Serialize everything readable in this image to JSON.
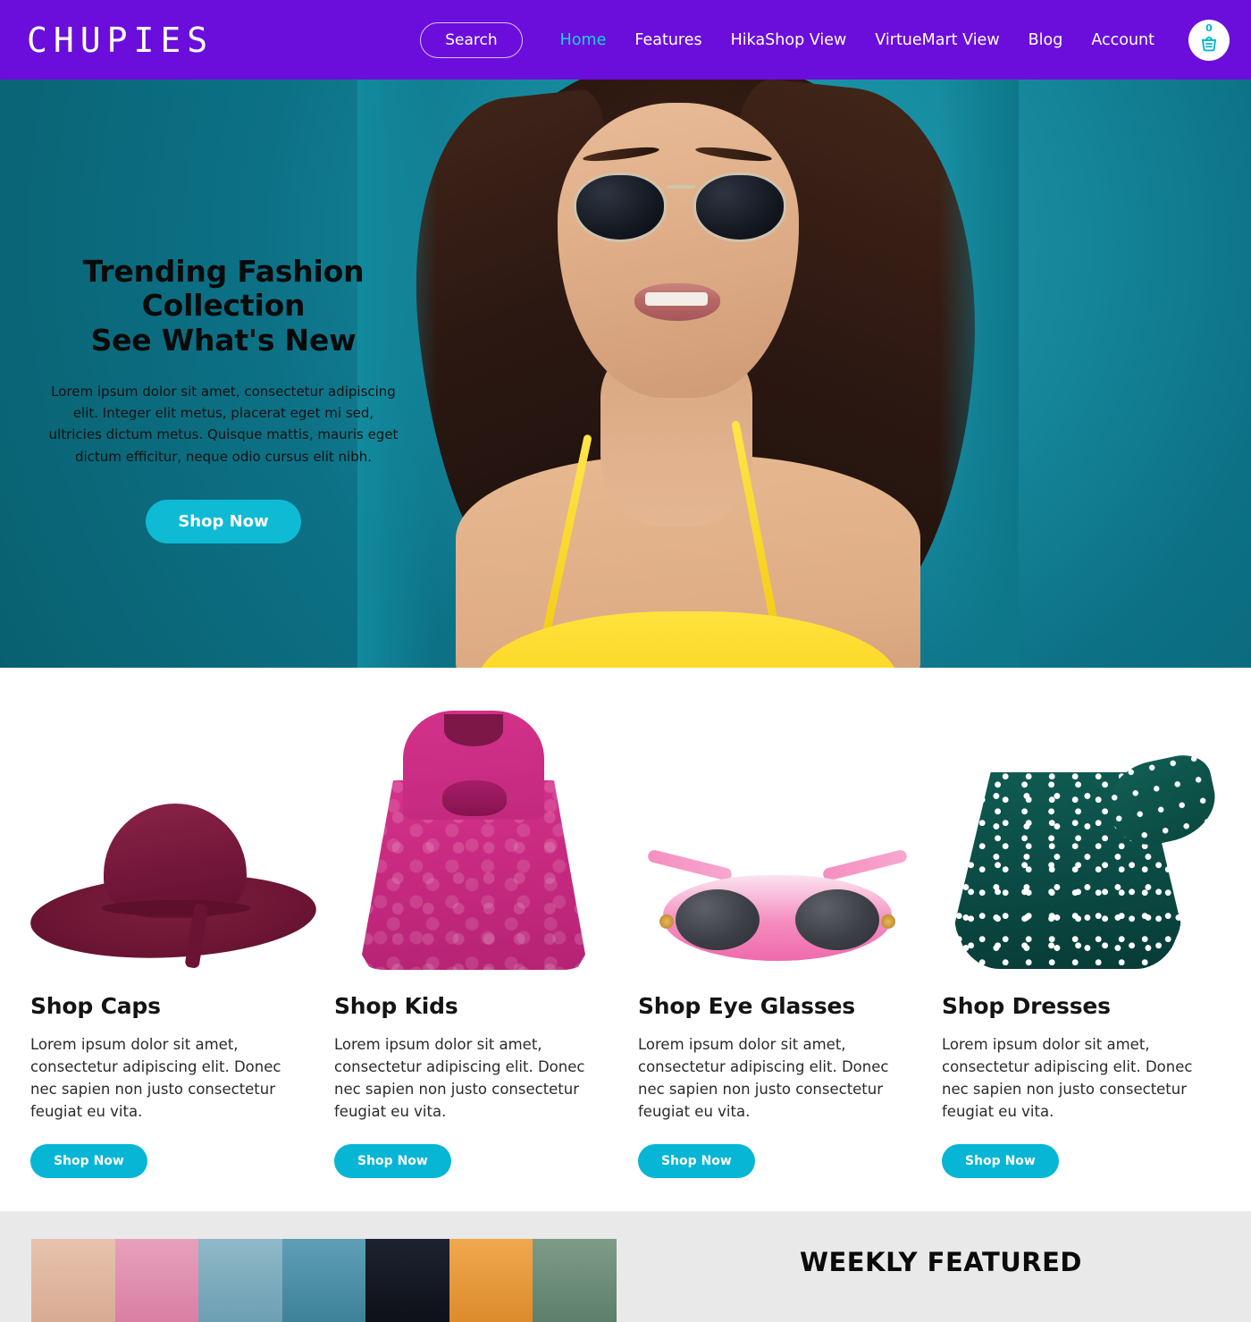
{
  "header": {
    "logo": "CHUPIES",
    "search_label": "Search",
    "nav": [
      {
        "label": "Home",
        "active": true
      },
      {
        "label": "Features",
        "active": false
      },
      {
        "label": "HikaShop View",
        "active": false
      },
      {
        "label": "VirtueMart View",
        "active": false
      },
      {
        "label": "Blog",
        "active": false
      },
      {
        "label": "Account",
        "active": false
      }
    ],
    "cart": {
      "count": "0",
      "icon": "shopping-basket-icon"
    },
    "brand_color": "#6b0edb",
    "accent_color": "#19d3e0"
  },
  "hero": {
    "title_line1": "Trending Fashion Collection",
    "title_line2": "See What's New",
    "description": "Lorem ipsum dolor sit amet, consectetur adipiscing elit. Integer elit metus, placerat eget mi sed, ultricies dictum metus. Quisque mattis, mauris eget dictum efficitur, neque odio cursus elit nibh.",
    "button_label": "Shop Now",
    "button_color": "#0fbad4",
    "background_color": "#0d7186"
  },
  "categories": [
    {
      "title": "Shop Caps",
      "description": "Lorem ipsum dolor sit amet, consectetur adipiscing elit. Donec nec sapien non justo consectetur feugiat eu vita.",
      "button_label": "Shop Now",
      "image_name": "burgundy-floppy-hat"
    },
    {
      "title": "Shop Kids",
      "description": "Lorem ipsum dolor sit amet, consectetur adipiscing elit. Donec nec sapien non justo consectetur feugiat eu vita.",
      "button_label": "Shop Now",
      "image_name": "pink-rosette-kids-dress"
    },
    {
      "title": "Shop Eye Glasses",
      "description": "Lorem ipsum dolor sit amet, consectetur adipiscing elit. Donec nec sapien non justo consectetur feugiat eu vita.",
      "button_label": "Shop Now",
      "image_name": "pink-sunglasses"
    },
    {
      "title": "Shop Dresses",
      "description": "Lorem ipsum dolor sit amet, consectetur adipiscing elit. Donec nec sapien non justo consectetur feugiat eu vita.",
      "button_label": "Shop Now",
      "image_name": "green-polka-dot-skirt"
    }
  ],
  "weekly": {
    "title": "WEEKLY FEATURED",
    "image_name": "row-of-dresses-photo",
    "background_color": "#e9e9e9"
  }
}
